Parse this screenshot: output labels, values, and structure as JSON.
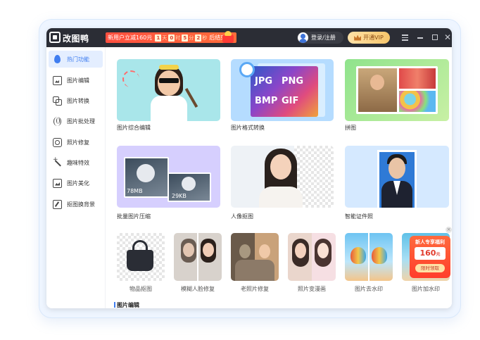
{
  "app": {
    "title": "改图鸭",
    "promo": {
      "text": "新用户立减160元",
      "countdown": [
        "1",
        "0",
        "5",
        "2"
      ],
      "units": [
        "天",
        "时",
        "分",
        "秒"
      ],
      "ends": "后结束"
    },
    "login": "登录/注册",
    "vip": "开通VIP"
  },
  "sidebar": {
    "items": [
      {
        "label": "热门功能",
        "icon": "drop-icon",
        "active": true
      },
      {
        "label": "图片编辑",
        "icon": "image-edit-icon"
      },
      {
        "label": "图片转换",
        "icon": "convert-icon"
      },
      {
        "label": "图片批处理",
        "icon": "batch-icon"
      },
      {
        "label": "照片修复",
        "icon": "repair-icon"
      },
      {
        "label": "趣味特效",
        "icon": "magic-wand-icon"
      },
      {
        "label": "图片美化",
        "icon": "beautify-icon"
      },
      {
        "label": "抠图换背景",
        "icon": "cutout-icon"
      }
    ]
  },
  "cards": {
    "large": [
      {
        "label": "图片综合编辑"
      },
      {
        "label": "图片格式转换",
        "formats": [
          "JPG",
          "PNG",
          "BMP",
          "GIF"
        ]
      },
      {
        "label": "拼图"
      },
      {
        "label": "批量图片压缩",
        "sizes": [
          "78MB",
          "29KB"
        ]
      },
      {
        "label": "人像抠图"
      },
      {
        "label": "智能证件照"
      }
    ],
    "small": [
      {
        "label": "物品抠图"
      },
      {
        "label": "模糊人脸修复"
      },
      {
        "label": "老照片修复"
      },
      {
        "label": "照片变漫画"
      },
      {
        "label": "图片去水印"
      },
      {
        "label": "图片加水印"
      }
    ]
  },
  "section_title": "图片编辑",
  "sticker": {
    "title": "新人专享福利",
    "price": "160",
    "unit": "元",
    "button": "限时领取"
  },
  "colors": {
    "accent": "#3f7df0",
    "titlebar": "#2b2d35",
    "promo": "#ff4f3f"
  }
}
